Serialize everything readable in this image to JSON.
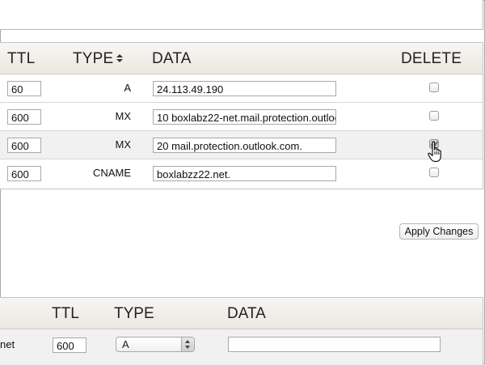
{
  "records_table": {
    "headers": {
      "ttl": "TTL",
      "type": "TYPE",
      "data": "DATA",
      "delete": "DELETE"
    },
    "rows": [
      {
        "ttl": "60",
        "type": "A",
        "data": "24.113.49.190",
        "delete": false
      },
      {
        "ttl": "600",
        "type": "MX",
        "data": "10 boxlabz22-net.mail.protection.outloo",
        "delete": false
      },
      {
        "ttl": "600",
        "type": "MX",
        "data": "20 mail.protection.outlook.com.",
        "delete": true
      },
      {
        "ttl": "600",
        "type": "CNAME",
        "data": "boxlabzz22.net.",
        "delete": false
      }
    ]
  },
  "apply_button": {
    "label": "Apply Changes"
  },
  "add_record": {
    "headers": {
      "ttl": "TTL",
      "type": "TYPE",
      "data": "DATA"
    },
    "name_fragment": "net",
    "ttl_value": "600",
    "type_selected": "A",
    "data_value": ""
  },
  "icons": {
    "sort": "sort-updown-icon",
    "cursor": "hand-pointer-icon"
  }
}
